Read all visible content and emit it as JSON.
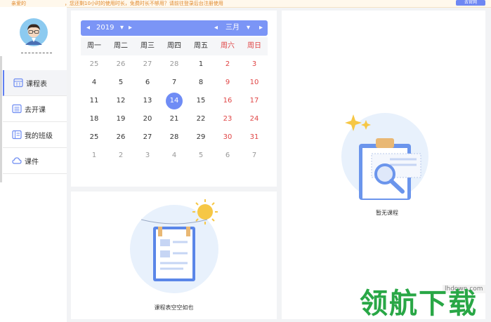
{
  "notice": {
    "text_left": "亲爱的",
    "text_main": "，您还剩10小时的使用时长，免费时长不够用？请前往登录后台注册使用",
    "button_label": "去官网"
  },
  "sidebar": {
    "menu": [
      {
        "label": "课程表",
        "icon": "calendar-icon",
        "active": true
      },
      {
        "label": "去开课",
        "icon": "list-icon",
        "active": false
      },
      {
        "label": "我的班级",
        "icon": "class-icon",
        "active": false
      },
      {
        "label": "课件",
        "icon": "cloud-icon",
        "active": false
      }
    ]
  },
  "calendar": {
    "prev_year": "◂",
    "year": "2019",
    "year_dropdown": "▾",
    "next_year": "▸",
    "prev_month": "◂",
    "month": "三月",
    "month_dropdown": "▾",
    "next_month": "▸",
    "weekdays": [
      "周一",
      "周二",
      "周三",
      "周四",
      "周五",
      "周六",
      "周日"
    ],
    "days": [
      [
        "25",
        "26",
        "27",
        "28",
        "1",
        "2",
        "3"
      ],
      [
        "4",
        "5",
        "6",
        "7",
        "8",
        "9",
        "10"
      ],
      [
        "11",
        "12",
        "13",
        "14",
        "15",
        "16",
        "17"
      ],
      [
        "18",
        "19",
        "20",
        "21",
        "22",
        "23",
        "24"
      ],
      [
        "25",
        "26",
        "27",
        "28",
        "29",
        "30",
        "31"
      ],
      [
        "1",
        "2",
        "3",
        "4",
        "5",
        "6",
        "7"
      ]
    ],
    "selected": "14",
    "weekend_color": "#e04545",
    "accent_color": "#6f8cf5"
  },
  "course_panel": {
    "empty_text": "课程表空空如也"
  },
  "right_panel": {
    "empty_text": "暂无课程"
  },
  "watermark": {
    "url": "lhdown.com",
    "brand": "领航下载"
  }
}
